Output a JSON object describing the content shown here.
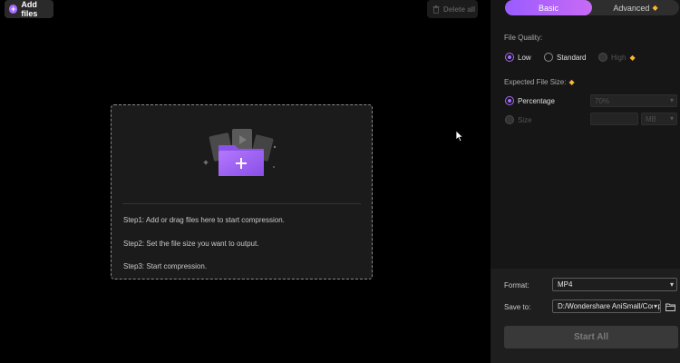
{
  "toolbar": {
    "add_files_label": "Add files",
    "delete_all_label": "Delete all"
  },
  "dropzone": {
    "step1": "Step1: Add or drag files here to start compression.",
    "step2": "Step2: Set the file size you want to output.",
    "step3": "Step3: Start compression."
  },
  "panel": {
    "tabs": [
      {
        "label": "Basic",
        "active": true
      },
      {
        "label": "Advanced",
        "active": false,
        "premium": true
      }
    ],
    "file_quality": {
      "label": "File Quality:",
      "options": [
        {
          "label": "Low",
          "selected": true
        },
        {
          "label": "Standard",
          "selected": false
        },
        {
          "label": "High",
          "selected": false,
          "disabled": true,
          "premium": true
        }
      ]
    },
    "expected_size": {
      "label": "Expected File Size:",
      "percentage_label": "Percentage",
      "percentage_value": "70%",
      "size_label": "Size",
      "size_value": "",
      "size_unit": "MB"
    },
    "format": {
      "label": "Format:",
      "value": "MP4"
    },
    "save_to": {
      "label": "Save to:",
      "value": "D:/Wondershare AniSmall/Comp"
    },
    "start_label": "Start All"
  },
  "colors": {
    "accent": "#a66bff",
    "gradient_start": "#9a5cff",
    "gradient_end": "#c86af5",
    "premium": "#ffb52e"
  },
  "icons": [
    "add-circle-icon",
    "trash-icon",
    "folder-add-icon",
    "diamond-icon",
    "chevron-down-icon",
    "folder-icon",
    "mouse-cursor-icon"
  ]
}
